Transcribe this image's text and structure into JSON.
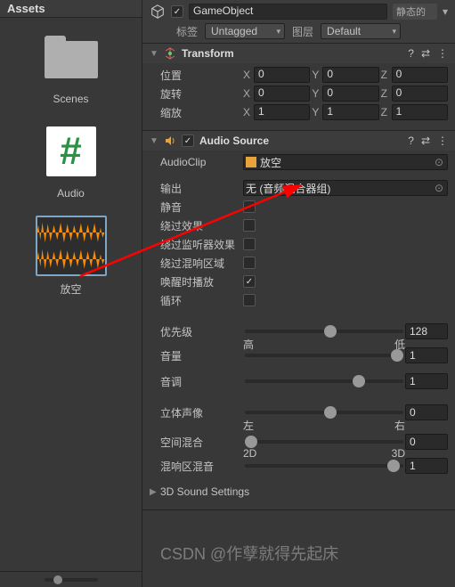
{
  "assets": {
    "title": "Assets",
    "items": [
      {
        "label": "Scenes",
        "kind": "folder"
      },
      {
        "label": "Audio",
        "kind": "hash"
      },
      {
        "label": "放空",
        "kind": "audio"
      }
    ]
  },
  "gameobject": {
    "name": "GameObject",
    "static_label": "静态的",
    "tag_label": "标签",
    "tag_value": "Untagged",
    "layer_label": "图层",
    "layer_value": "Default"
  },
  "transform": {
    "title": "Transform",
    "position": {
      "label": "位置",
      "x": "0",
      "y": "0",
      "z": "0"
    },
    "rotation": {
      "label": "旋转",
      "x": "0",
      "y": "0",
      "z": "0"
    },
    "scale": {
      "label": "缩放",
      "x": "1",
      "y": "1",
      "z": "1"
    }
  },
  "audio_source": {
    "title": "Audio Source",
    "clip_label": "AudioClip",
    "clip_value": "放空",
    "output_label": "输出",
    "output_value": "无 (音频混合器组)",
    "mute_label": "静音",
    "bypass_effects_label": "绕过效果",
    "bypass_listener_label": "绕过监听器效果",
    "bypass_reverb_label": "绕过混响区域",
    "play_on_awake_label": "唤醒时播放",
    "play_on_awake": true,
    "loop_label": "循环",
    "priority": {
      "label": "优先级",
      "value": "128",
      "left": "高",
      "right": "低",
      "pos": 50
    },
    "volume": {
      "label": "音量",
      "value": "1",
      "pos": 100
    },
    "pitch": {
      "label": "音调",
      "value": "1",
      "pos": 68
    },
    "stereo": {
      "label": "立体声像",
      "value": "0",
      "left": "左",
      "right": "右",
      "pos": 50
    },
    "spatial": {
      "label": "空间混合",
      "value": "0",
      "left": "2D",
      "right": "3D",
      "pos": 0
    },
    "reverb": {
      "label": "混响区混音",
      "value": "1",
      "pos": 90
    },
    "sound3d_label": "3D Sound Settings"
  },
  "watermark": "CSDN @作孽就得先起床"
}
